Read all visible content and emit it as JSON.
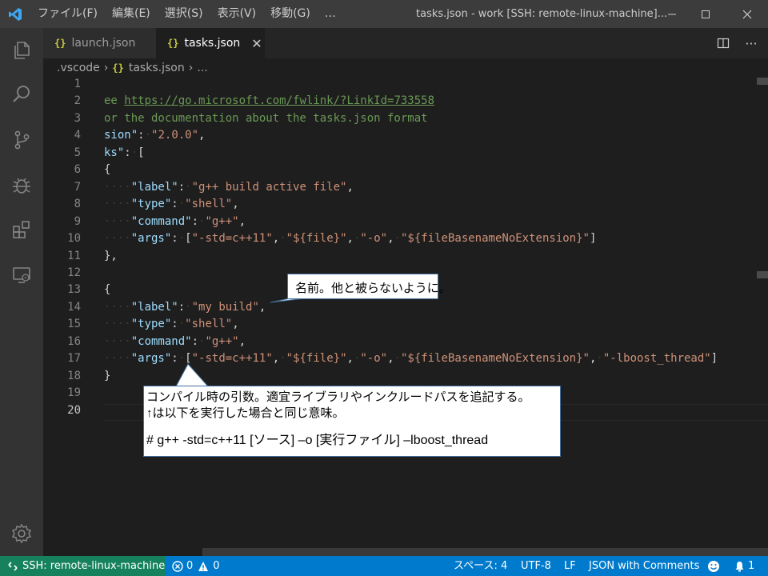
{
  "titlebar": {
    "menu": [
      "ファイル(F)",
      "編集(E)",
      "選択(S)",
      "表示(V)",
      "移動(G)",
      "…"
    ],
    "window_title": "tasks.json - work [SSH: remote-linux-machine]...",
    "accent_color": "#3c3c3c"
  },
  "activitybar": {
    "icons": [
      "explorer-icon",
      "search-icon",
      "source-control-icon",
      "debug-icon",
      "extensions-icon",
      "remote-explorer-icon",
      "settings-gear-icon"
    ]
  },
  "tabs": [
    {
      "label": "launch.json",
      "active": false
    },
    {
      "label": "tasks.json",
      "active": true
    }
  ],
  "breadcrumb": {
    "folder": ".vscode",
    "file": "tasks.json",
    "more": "..."
  },
  "editor": {
    "lines": [
      {
        "n": "1",
        "text": ""
      },
      {
        "n": "2",
        "text": "ee https://go.microsoft.com/fwlink/?LinkId=733558"
      },
      {
        "n": "3",
        "text": "or the documentation about the tasks.json format"
      },
      {
        "n": "4",
        "text": "sion\": \"2.0.0\","
      },
      {
        "n": "5",
        "text": "ks\": ["
      },
      {
        "n": "6",
        "text": "{"
      },
      {
        "n": "7",
        "text": "    \"label\": \"g++ build active file\","
      },
      {
        "n": "8",
        "text": "    \"type\": \"shell\","
      },
      {
        "n": "9",
        "text": "    \"command\": \"g++\","
      },
      {
        "n": "10",
        "text": "    \"args\": [\"-std=c++11\", \"${file}\", \"-o\", \"${fileBasenameNoExtension}\"]"
      },
      {
        "n": "11",
        "text": "},"
      },
      {
        "n": "12",
        "text": ""
      },
      {
        "n": "13",
        "text": "{"
      },
      {
        "n": "14",
        "text": "    \"label\": \"my build\","
      },
      {
        "n": "15",
        "text": "    \"type\": \"shell\","
      },
      {
        "n": "16",
        "text": "    \"command\": \"g++\","
      },
      {
        "n": "17",
        "text": "    \"args\": [\"-std=c++11\", \"${file}\", \"-o\", \"${fileBasenameNoExtension}\", \"-lboost_thread\"]"
      },
      {
        "n": "18",
        "text": "}"
      },
      {
        "n": "19",
        "text": ""
      },
      {
        "n": "20",
        "text": ""
      }
    ],
    "active_line": "20"
  },
  "callouts": {
    "name_note": "名前。他と被らないように。",
    "args_note_line1": "コンパイル時の引数。適宜ライブラリやインクルードパスを追記する。",
    "args_note_line2": "↑は以下を実行した場合と同じ意味。",
    "args_note_line3": "# g++ -std=c++11 [ソース] –o [実行ファイル] –lboost_thread"
  },
  "statusbar": {
    "remote": "SSH: remote-linux-machine",
    "errors": "0",
    "warnings": "0",
    "indent": "スペース: 4",
    "encoding": "UTF-8",
    "eol": "LF",
    "language": "JSON with Comments",
    "notifications": "1",
    "bar_color": "#007acc",
    "remote_color": "#16825d"
  }
}
